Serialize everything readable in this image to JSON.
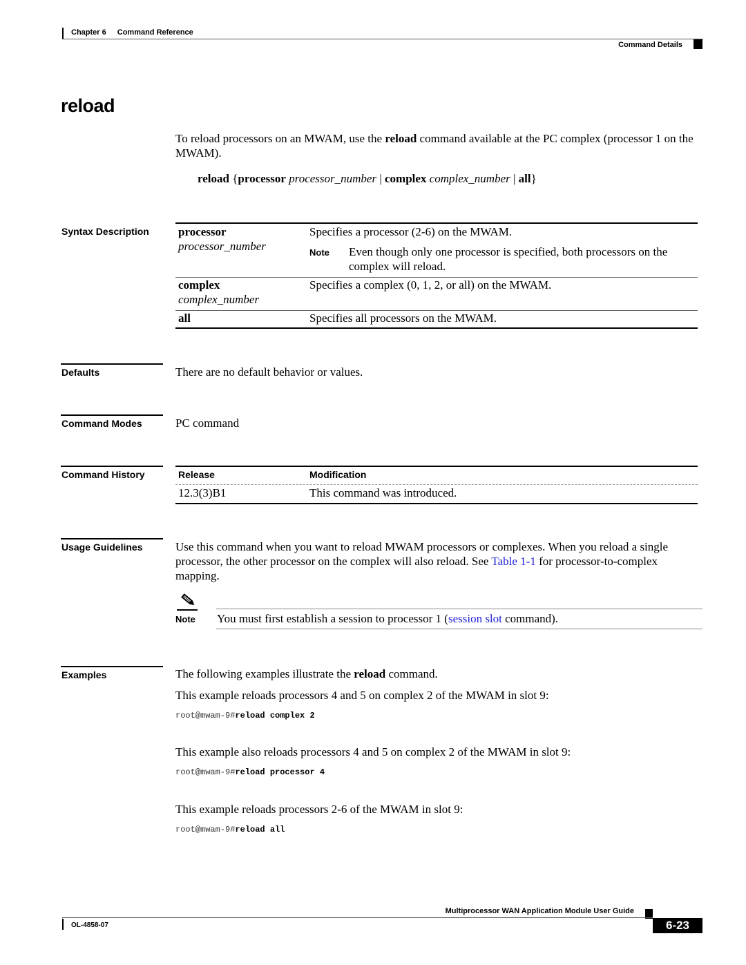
{
  "header": {
    "chapter": "Chapter 6",
    "chapter_title": "Command Reference",
    "section": "Command Details"
  },
  "title": "reload",
  "intro": {
    "before": "To reload processors on an MWAM, use the ",
    "keyword": "reload",
    "after": " command available at the PC complex (processor 1 on the MWAM)."
  },
  "syntax": {
    "cmd": "reload",
    "open_brace": "{",
    "kw1": "processor",
    "arg1": "processor_number",
    "pipe": "|",
    "kw2": "complex",
    "arg2": "complex_number",
    "kw3": "all",
    "close_brace": "}"
  },
  "syntax_description": {
    "label": "Syntax Description",
    "rows": [
      {
        "keyword": "processor",
        "argument": "processor_number",
        "description": "Specifies a processor (2-6) on the MWAM.",
        "note_label": "Note",
        "note": "Even though only one processor is specified, both processors on the complex will reload."
      },
      {
        "keyword": "complex",
        "argument": "complex_number",
        "description": "Specifies a complex (0, 1, 2, or all) on the MWAM."
      },
      {
        "keyword": "all",
        "description": "Specifies all processors on the MWAM."
      }
    ]
  },
  "defaults": {
    "label": "Defaults",
    "text": "There are no default behavior or values."
  },
  "command_modes": {
    "label": "Command Modes",
    "text": "PC command"
  },
  "command_history": {
    "label": "Command History",
    "columns": [
      "Release",
      "Modification"
    ],
    "rows": [
      [
        "12.3(3)B1",
        "This command was introduced."
      ]
    ]
  },
  "usage_guidelines": {
    "label": "Usage Guidelines",
    "text_before": "Use this command when you want to reload MWAM processors or complexes. When you reload a single processor, the other processor on the complex will also reload. See ",
    "link": "Table 1-1",
    "text_after": " for processor-to-complex mapping.",
    "note_label": "Note",
    "note_before": "You must first establish a session to processor 1 (",
    "note_link": "session slot",
    "note_after": " command)."
  },
  "examples": {
    "label": "Examples",
    "intro_before": "The following examples illustrate the ",
    "intro_keyword": "reload",
    "intro_after": " command.",
    "items": [
      {
        "description": "This example reloads processors 4 and 5 on complex 2 of the MWAM in slot 9:",
        "prompt": "root@mwam-9#",
        "command": "reload complex 2"
      },
      {
        "description": "This example also reloads processors 4 and 5 on complex 2 of the MWAM in slot 9:",
        "prompt": "root@mwam-9#",
        "command": "reload processor 4"
      },
      {
        "description": "This example reloads processors 2-6 of the MWAM in slot 9:",
        "prompt": "root@mwam-9#",
        "command": "reload all"
      }
    ]
  },
  "footer": {
    "guide_title": "Multiprocessor WAN Application Module User Guide",
    "doc_number": "OL-4858-07",
    "page": "6-23"
  },
  "colors": {
    "link": "#1f1fd6"
  }
}
